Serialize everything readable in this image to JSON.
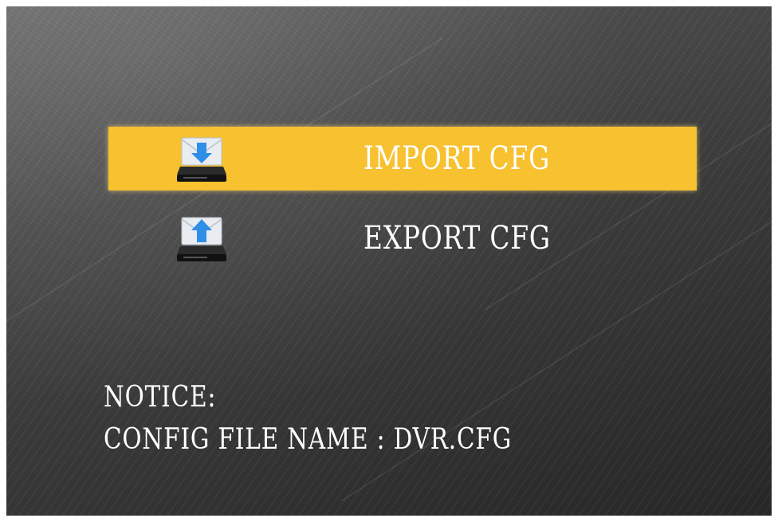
{
  "menu": {
    "items": [
      {
        "label": "IMPORT CFG",
        "icon": "import-drive-icon",
        "selected": true
      },
      {
        "label": "EXPORT CFG",
        "icon": "export-drive-icon",
        "selected": false
      }
    ]
  },
  "notice": {
    "title": "NOTICE:",
    "text": "CONFIG FILE NAME : DVR.CFG"
  },
  "colors": {
    "highlight": "#f7c130",
    "text": "#ffffff",
    "arrow": "#2f8fe6"
  }
}
